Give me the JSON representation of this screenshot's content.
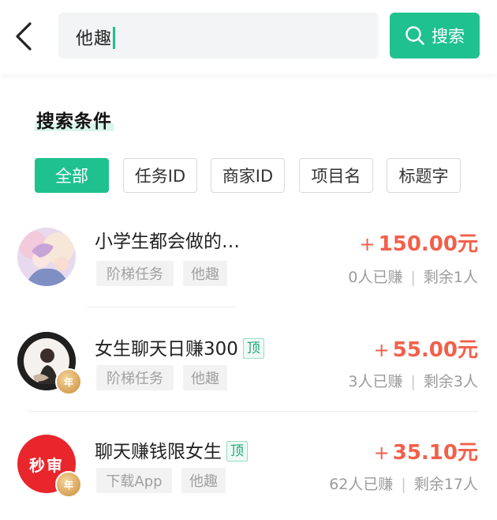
{
  "search": {
    "query": "他趣",
    "button_label": "搜索"
  },
  "conditions": {
    "title": "搜索条件",
    "filters": [
      "全部",
      "任务ID",
      "商家ID",
      "项目名",
      "标题字"
    ],
    "active_index": 0
  },
  "tasks": [
    {
      "title": "小学生都会做的…",
      "tags": [
        "阶梯任务",
        "他趣"
      ],
      "price": "150.00元",
      "price_prefix": "+",
      "earned": "0人已赚",
      "remaining": "剩余1人",
      "pinned": false,
      "avatar": "anime-avatar"
    },
    {
      "title": "女生聊天日赚300",
      "badge": "顶",
      "tags": [
        "阶梯任务",
        "他趣"
      ],
      "price": "55.00元",
      "price_prefix": "+",
      "earned": "3人已赚",
      "remaining": "剩余3人",
      "pinned": true,
      "avatar": "photo-avatar",
      "medal": "年"
    },
    {
      "title": "聊天赚钱限女生",
      "badge": "顶",
      "tags": [
        "下载App",
        "他趣"
      ],
      "price": "35.10元",
      "price_prefix": "+",
      "earned": "62人已赚",
      "remaining": "剩余17人",
      "pinned": true,
      "avatar_text": "秒审",
      "avatar_color": "#e8262b",
      "medal": "年"
    }
  ],
  "colors": {
    "accent": "#1fc18f",
    "price": "#f2604a"
  }
}
